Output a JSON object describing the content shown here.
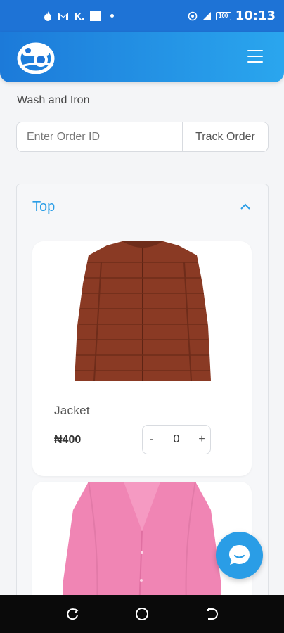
{
  "status_bar": {
    "time": "10:13",
    "left_icons": [
      "flame-icon",
      "gmail-icon",
      "k-icon",
      "square-icon",
      "dot-icon"
    ],
    "k_label": "K.",
    "battery": "100",
    "right_icons": [
      "hotspot-icon",
      "signal-icon",
      "battery-icon"
    ]
  },
  "header": {
    "logo": "laundry-logo",
    "menu_icon": "hamburger-menu-icon"
  },
  "service": {
    "title": "Wash and Iron"
  },
  "track": {
    "placeholder": "Enter Order ID",
    "value": "",
    "button_label": "Track Order"
  },
  "category": {
    "title": "Top",
    "expanded": true,
    "items": [
      {
        "name": "Jacket",
        "price": "₦400",
        "quantity": "0",
        "minus_label": "-",
        "plus_label": "+",
        "image": "brown-puffer-jacket",
        "color": "#8a3a24"
      },
      {
        "image": "pink-shirt",
        "color": "#f085b4"
      }
    ]
  },
  "chat": {
    "icon": "chat-bubble-icon"
  },
  "colors": {
    "primary": "#1e73d6",
    "accent": "#2a9de6"
  },
  "nav_bar": {
    "buttons": [
      "recent-apps-icon",
      "home-icon",
      "back-icon"
    ]
  }
}
